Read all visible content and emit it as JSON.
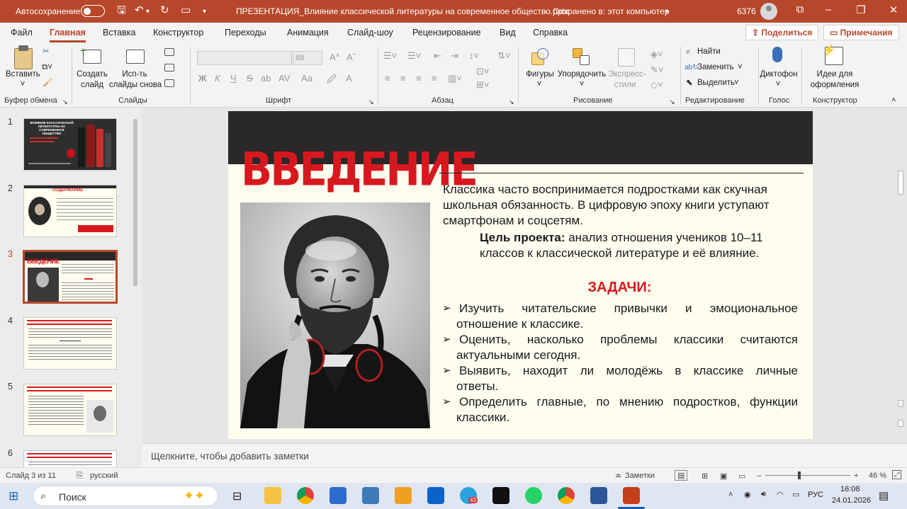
{
  "titlebar": {
    "autosave_label": "Автосохранение",
    "document_title": "ПРЕЗЕНТАЦИЯ_Влияние классической литературы на современное общество.pptx",
    "save_status": "Сохранено в: этот компьютер",
    "user_id": "6376",
    "accent_color": "#b7472a"
  },
  "menu": {
    "tabs": [
      "Файл",
      "Главная",
      "Вставка",
      "Конструктор",
      "Переходы",
      "Анимация",
      "Слайд-шоу",
      "Рецензирование",
      "Вид",
      "Справка"
    ],
    "active_tab": "Главная",
    "share_label": "Поделиться",
    "comments_label": "Примечания"
  },
  "ribbon": {
    "clipboard": {
      "paste": "Вставить",
      "group": "Буфер обмена"
    },
    "slides": {
      "new_slide_1": "Создать",
      "new_slide_2": "слайд",
      "reuse_1": "Исп-ть",
      "reuse_2": "слайды снова",
      "group": "Слайды"
    },
    "font": {
      "size": "88",
      "group": "Шрифт",
      "bold": "Ж",
      "italic": "К",
      "underline": "Ч",
      "strike": "S"
    },
    "paragraph": {
      "group": "Абзац"
    },
    "drawing": {
      "shapes": "Фигуры",
      "arrange": "Упорядочить",
      "styles_1": "Экспресс-",
      "styles_2": "стили",
      "group": "Рисование"
    },
    "editing": {
      "find": "Найти",
      "replace": "Заменить",
      "select": "Выделить",
      "group": "Редактирование"
    },
    "voice": {
      "dictate": "Диктофон",
      "group": "Голос"
    },
    "designer": {
      "ideas_1": "Идеи для",
      "ideas_2": "оформления",
      "group": "Конструктор"
    }
  },
  "thumbnails": {
    "numbers": [
      "1",
      "2",
      "3",
      "4",
      "5",
      "6"
    ],
    "selected": "3",
    "t1_title": "ВЛИЯНИЕ КЛАССИЧЕСКОЙ ЛИТЕРАТУРЫ НА СОВРЕМЕННОЕ ОБЩЕСТВО",
    "t2_title": "СОДЕРЖАНИЕ",
    "t3_title": "ВВЕДЕНИЕ"
  },
  "slide": {
    "title": "ВВЕДЕНИЕ",
    "intro": "Классика часто воспринимается подростками как скучная школьная обязанность. В цифровую эпоху книги уступают смартфонам и соцсетям.",
    "goal_label": "Цель проекта:",
    "goal_text": " анализ отношения учеников 10–11 классов к классической литературе и её влияние.",
    "tasks_heading": "ЗАДАЧИ:",
    "tasks": [
      {
        "line1": "Изучить читательские привычки и эмоциональное",
        "line2": "отношение к классике."
      },
      {
        "line1": "Оценить, насколько проблемы классики считаются",
        "line2": "актуальными сегодня."
      },
      {
        "line1": "Выявить, находит ли молодёжь в классике личные",
        "line2": "ответы."
      },
      {
        "line1": "Определить главные, по мнению подростков, функции",
        "line2": "классики."
      }
    ],
    "bullet": "➢",
    "title_color": "#d7191f",
    "band_color": "#2a2828",
    "bg_color": "#fefdee"
  },
  "notes": {
    "placeholder": "Щелкните, чтобы добавить заметки"
  },
  "status": {
    "slide_info": "Слайд 3 из 11",
    "language": "русский",
    "notes_btn": "Заметки",
    "zoom": "46 %"
  },
  "taskbar": {
    "search": "Поиск",
    "language": "РУС",
    "time": "16:08",
    "date": "24.01.2026",
    "telegram_badge": "43"
  }
}
